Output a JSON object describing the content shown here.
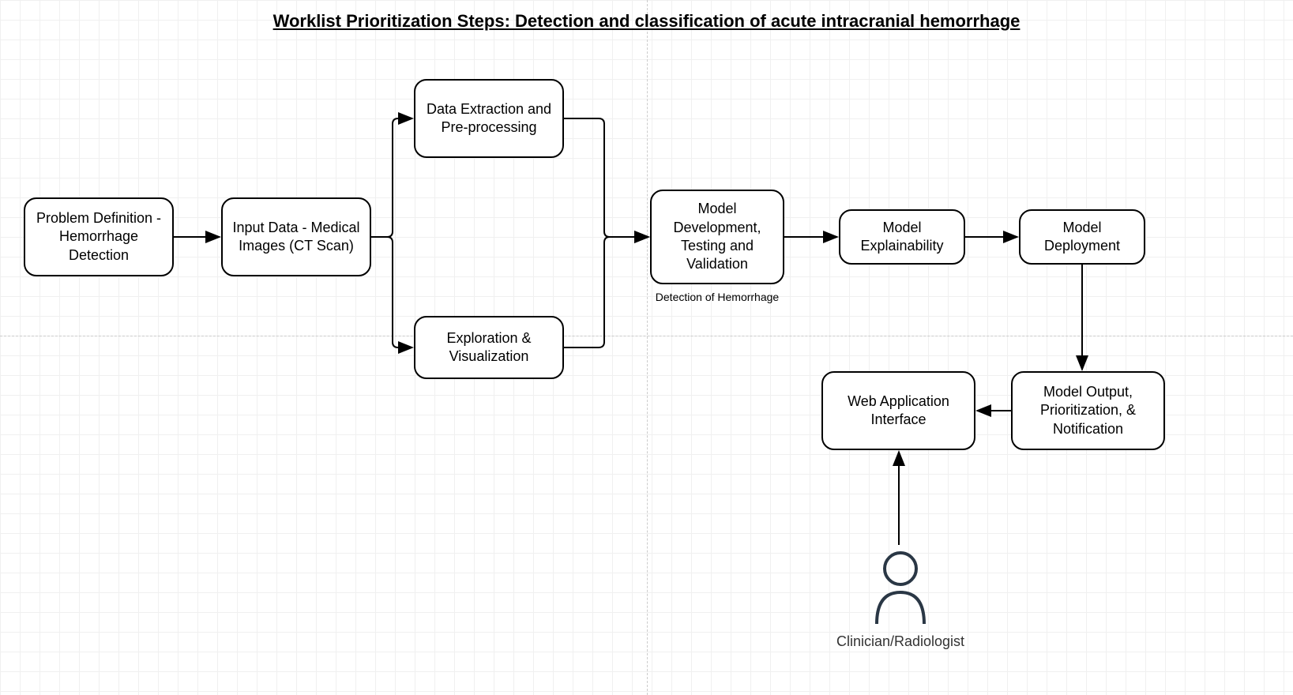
{
  "title": "Worklist Prioritization Steps: Detection and classification of acute intracranial hemorrhage",
  "nodes": {
    "problem": "Problem Definition - Hemorrhage Detection",
    "input": "Input Data - Medical Images (CT Scan)",
    "extract": "Data Extraction and Pre-processing",
    "explore": "Exploration & Visualization",
    "model_dev": "Model Development, Testing and Validation",
    "model_dev_caption": "Detection of Hemorrhage",
    "explain": "Model Explainability",
    "deploy": "Model Deployment",
    "output": "Model Output, Prioritization, & Notification",
    "webapp": "Web Application Interface",
    "person": "Clinician/Radiologist"
  }
}
